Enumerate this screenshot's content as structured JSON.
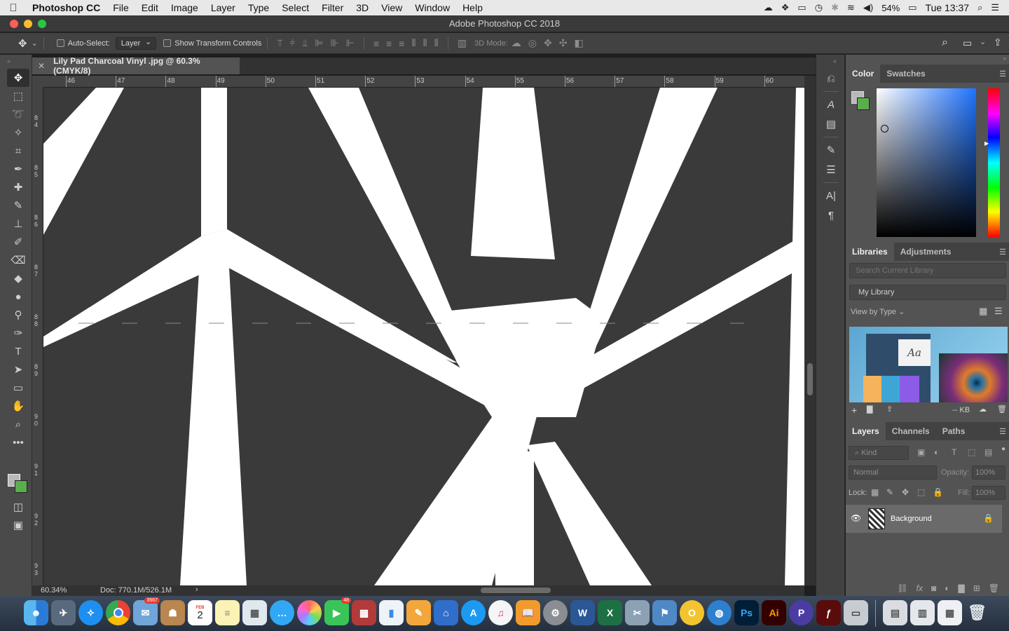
{
  "menubar": {
    "apple": "",
    "app_name": "Photoshop CC",
    "items": [
      "File",
      "Edit",
      "Image",
      "Layer",
      "Type",
      "Select",
      "Filter",
      "3D",
      "View",
      "Window",
      "Help"
    ],
    "battery": "54%",
    "clock": "Tue 13:37"
  },
  "window": {
    "title": "Adobe Photoshop CC 2018"
  },
  "options_bar": {
    "auto_select_label": "Auto-Select:",
    "auto_select_value": "Layer",
    "show_transform_label": "Show Transform Controls",
    "mode_3d_label": "3D Mode:"
  },
  "document": {
    "tab_title": "Lily Pad Charcoal Vinyl .jpg @ 60.3% (CMYK/8)",
    "close_glyph": "✕",
    "ruler_top_labels": [
      "46",
      "47",
      "48",
      "49",
      "50",
      "51",
      "52",
      "53",
      "54",
      "55",
      "56",
      "57",
      "58",
      "59",
      "60"
    ],
    "ruler_left_labels": [
      "84",
      "85",
      "86",
      "87",
      "88",
      "89",
      "90",
      "91",
      "92",
      "93"
    ],
    "bg_color": "#3a3a3a",
    "line_color": "#ffffff"
  },
  "status": {
    "zoom": "60.34%",
    "doc": "Doc: 770.1M/526.1M",
    "arrow": "›"
  },
  "color_panel": {
    "tabs": [
      "Color",
      "Swatches"
    ],
    "foreground": "#b9b9b9",
    "background": "#5cad4e"
  },
  "libraries_panel": {
    "tabs": [
      "Libraries",
      "Adjustments"
    ],
    "search_placeholder": "Search Current Library",
    "library_name": "My Library",
    "view_by": "View by Type",
    "thumb_text": "Aa",
    "size": "-- KB"
  },
  "layers_panel": {
    "tabs": [
      "Layers",
      "Channels",
      "Paths"
    ],
    "kind_label": "Kind",
    "blend_mode": "Normal",
    "opacity_label": "Opacity:",
    "opacity_value": "100%",
    "lock_label": "Lock:",
    "fill_label": "Fill:",
    "fill_value": "100%",
    "layers": [
      {
        "name": "Background",
        "visible": true,
        "locked": true
      }
    ]
  },
  "dock": {
    "badge_mail": "3567",
    "badge_calendar_month": "FEB",
    "badge_calendar_day": "2",
    "badge_facetime": "48",
    "app_labels": [
      "Ps",
      "Ai"
    ]
  }
}
